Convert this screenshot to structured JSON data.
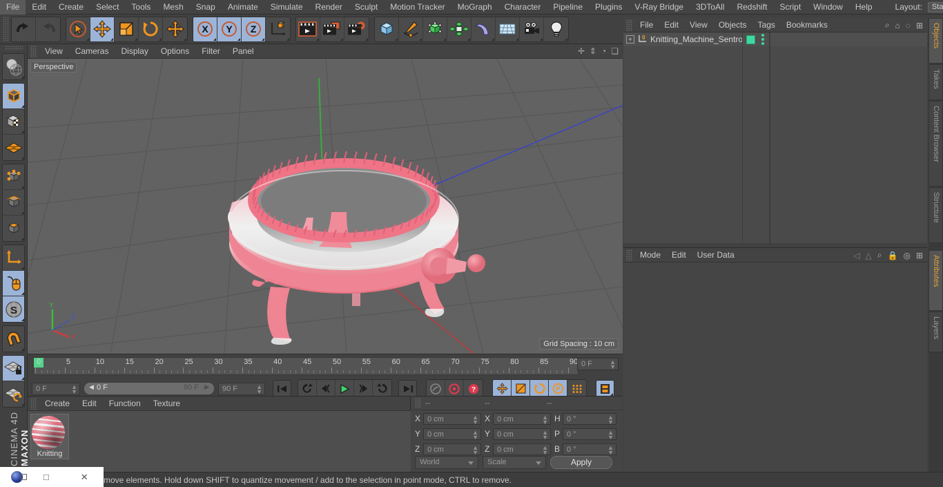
{
  "app": {
    "brand_top": "MAXON",
    "brand_bottom": "CINEMA 4D"
  },
  "menubar": {
    "items": [
      {
        "label": "File"
      },
      {
        "label": "Edit"
      },
      {
        "label": "Create"
      },
      {
        "label": "Select"
      },
      {
        "label": "Tools"
      },
      {
        "label": "Mesh"
      },
      {
        "label": "Snap"
      },
      {
        "label": "Animate"
      },
      {
        "label": "Simulate"
      },
      {
        "label": "Render"
      },
      {
        "label": "Sculpt"
      },
      {
        "label": "Motion Tracker"
      },
      {
        "label": "MoGraph"
      },
      {
        "label": "Character"
      },
      {
        "label": "Pipeline"
      },
      {
        "label": "Plugins"
      },
      {
        "label": "V-Ray Bridge"
      },
      {
        "label": "3DToAll"
      },
      {
        "label": "Redshift"
      },
      {
        "label": "Script"
      },
      {
        "label": "Window"
      },
      {
        "label": "Help"
      }
    ],
    "layout_label": "Layout:",
    "layout_value": "Startup",
    "search_icon": "search-icon"
  },
  "toolbar": {
    "groups": [
      {
        "name": "history",
        "buttons": [
          {
            "name": "undo-button",
            "icon": "undo-arrow-icon",
            "active": false
          },
          {
            "name": "redo-button",
            "icon": "redo-arrow-icon",
            "active": false
          }
        ]
      },
      {
        "name": "transform-tools",
        "buttons": [
          {
            "name": "live-selection-tool",
            "icon": "cursor-circle-icon",
            "active": false
          },
          {
            "name": "move-tool",
            "icon": "move-arrows-icon",
            "active": true
          },
          {
            "name": "scale-tool",
            "icon": "scale-box-icon",
            "active": false
          },
          {
            "name": "rotate-tool",
            "icon": "rotate-circle-icon",
            "active": false
          },
          {
            "name": "coordinate-move-tool",
            "icon": "move-arrows-icon",
            "active": false
          }
        ]
      },
      {
        "name": "axis-locks",
        "buttons": [
          {
            "name": "lock-x-axis",
            "icon": "x-axis-icon",
            "active": true
          },
          {
            "name": "lock-y-axis",
            "icon": "y-axis-icon",
            "active": true
          },
          {
            "name": "lock-z-axis",
            "icon": "z-axis-icon",
            "active": true
          },
          {
            "name": "world-object-axis",
            "icon": "axis-cube-icon",
            "active": false
          }
        ]
      },
      {
        "name": "render-group",
        "buttons": [
          {
            "name": "render-view-button",
            "icon": "clapperboard-icon",
            "active": false
          },
          {
            "name": "render-to-picture-viewer-button",
            "icon": "clapperboard-window-icon",
            "active": false
          },
          {
            "name": "render-settings-button",
            "icon": "clapperboard-gear-icon",
            "active": false
          }
        ]
      },
      {
        "name": "create-group",
        "buttons": [
          {
            "name": "add-cube-button",
            "icon": "blue-cube-icon",
            "active": false
          },
          {
            "name": "add-spline-button",
            "icon": "pen-spline-icon",
            "active": false
          },
          {
            "name": "add-generator-button",
            "icon": "green-cube-icon",
            "active": false
          },
          {
            "name": "add-mograph-button",
            "icon": "green-cluster-icon",
            "active": false
          },
          {
            "name": "add-deformer-button",
            "icon": "bend-deformer-icon",
            "active": false
          },
          {
            "name": "add-scene-object-button",
            "icon": "floor-grid-icon",
            "active": false
          },
          {
            "name": "add-camera-button",
            "icon": "camera-icon",
            "active": false
          },
          {
            "name": "add-light-button",
            "icon": "lightbulb-icon",
            "active": false
          }
        ]
      }
    ]
  },
  "left_toolbar": {
    "groups": [
      {
        "name": "modeling-mode",
        "buttons": [
          {
            "name": "make-editable-button",
            "icon": "globe-sphere-icon",
            "active": false
          }
        ]
      },
      {
        "name": "object-mode-group",
        "buttons": [
          {
            "name": "model-mode-button",
            "icon": "model-cube-icon",
            "active": true
          },
          {
            "name": "texture-mode-button",
            "icon": "texture-checker-cube-icon",
            "active": false
          },
          {
            "name": "workplane-mode-button",
            "icon": "workplane-grid-icon",
            "active": false
          }
        ]
      },
      {
        "name": "component-mode-group",
        "buttons": [
          {
            "name": "points-mode-button",
            "icon": "points-cube-icon",
            "active": false
          },
          {
            "name": "edges-mode-button",
            "icon": "edges-cube-icon",
            "active": false
          },
          {
            "name": "polygons-mode-button",
            "icon": "polygons-cube-icon",
            "active": false
          }
        ]
      },
      {
        "name": "axis-group",
        "buttons": [
          {
            "name": "enable-axis-button",
            "icon": "axis-l-icon",
            "active": false
          },
          {
            "name": "viewport-solo-button",
            "icon": "mouse-icon",
            "active": true
          },
          {
            "name": "symmetry-mode-button",
            "icon": "s-sphere-icon",
            "active": true
          }
        ]
      },
      {
        "name": "snap-group",
        "buttons": [
          {
            "name": "enable-snap-button",
            "icon": "magnet-icon",
            "active": false
          }
        ]
      },
      {
        "name": "workplane-group",
        "buttons": [
          {
            "name": "lock-workplane-button",
            "icon": "workplane-lock-icon",
            "active": true
          },
          {
            "name": "planar-workplane-button",
            "icon": "workplane-rotate-icon",
            "active": false
          }
        ]
      }
    ]
  },
  "viewport": {
    "menu": [
      {
        "label": "View"
      },
      {
        "label": "Cameras"
      },
      {
        "label": "Display"
      },
      {
        "label": "Options"
      },
      {
        "label": "Filter"
      },
      {
        "label": "Panel"
      }
    ],
    "corner_icons": [
      "pan-icon",
      "dolly-icon",
      "rotate-icon",
      "maximize-icon"
    ],
    "view_label": "Perspective",
    "grid_spacing_label": "Grid Spacing : 10 cm",
    "axis_gizmo": {
      "x": "X",
      "y": "Y",
      "z": "Z",
      "x_color": "#d23a3a",
      "y_color": "#3ac03a",
      "z_color": "#3a54d2"
    },
    "model": {
      "name": "knitting-machine-model",
      "body_color": "#e8707f",
      "highlight_color": "#efefef"
    }
  },
  "timeline": {
    "ruler_labels": [
      "0",
      "5",
      "10",
      "15",
      "20",
      "25",
      "30",
      "35",
      "40",
      "45",
      "50",
      "55",
      "60",
      "65",
      "70",
      "75",
      "80",
      "85",
      "90"
    ],
    "range_start": 0,
    "range_end": 90,
    "current_frame_field": "0 F",
    "preview_start": "0 F",
    "preview_end": "90 F",
    "max_frame_field": "90 F",
    "right_frame_field": "0 F",
    "transport": [
      {
        "name": "go-to-start-button",
        "icon": "skip-start-icon",
        "active": false
      },
      {
        "name": "play-backwards-loop-button",
        "icon": "loop-back-icon",
        "active": false
      },
      {
        "name": "step-back-button",
        "icon": "step-back-icon",
        "active": false
      },
      {
        "name": "play-button",
        "icon": "play-icon",
        "active": false
      },
      {
        "name": "step-forward-button",
        "icon": "step-forward-icon",
        "active": false
      },
      {
        "name": "play-forward-loop-button",
        "icon": "loop-forward-icon",
        "active": false
      },
      {
        "name": "go-to-end-button",
        "icon": "skip-end-icon",
        "active": false
      }
    ],
    "record_group": [
      {
        "name": "record-active-objects-button",
        "icon": "key-icon",
        "active": false
      },
      {
        "name": "autokeying-button",
        "icon": "red-circle-icon",
        "active": false
      },
      {
        "name": "keyframe-selection-button",
        "icon": "red-question-icon",
        "active": false
      }
    ],
    "key_toggles": [
      {
        "name": "position-key-button",
        "icon": "move-arrows-icon",
        "active": true
      },
      {
        "name": "scale-key-button",
        "icon": "scale-box-icon",
        "active": true
      },
      {
        "name": "rotation-key-button",
        "icon": "rotate-circle-icon",
        "active": true
      },
      {
        "name": "parameter-key-button",
        "icon": "p-circle-icon",
        "active": true
      },
      {
        "name": "pla-key-button",
        "icon": "dots-grid-icon",
        "active": false
      }
    ],
    "film_button": {
      "name": "timeline-mode-button",
      "icon": "film-strip-icon",
      "active": true
    }
  },
  "material_manager": {
    "menu": [
      {
        "label": "Create"
      },
      {
        "label": "Edit"
      },
      {
        "label": "Function"
      },
      {
        "label": "Texture"
      }
    ],
    "materials": [
      {
        "name": "material-knitting",
        "label": "Knitting",
        "color": "#e8707f"
      }
    ]
  },
  "coordinates": {
    "headers": [
      "--",
      "--",
      "--"
    ],
    "rows": [
      {
        "pos_label": "X",
        "pos_value": "0 cm",
        "size_label": "X",
        "size_value": "0 cm",
        "rot_label": "H",
        "rot_value": "0 °"
      },
      {
        "pos_label": "Y",
        "pos_value": "0 cm",
        "size_label": "Y",
        "size_value": "0 cm",
        "rot_label": "P",
        "rot_value": "0 °"
      },
      {
        "pos_label": "Z",
        "pos_value": "0 cm",
        "size_label": "Z",
        "size_value": "0 cm",
        "rot_label": "B",
        "rot_value": "0 °"
      }
    ],
    "system_value": "World",
    "mode_value": "Scale",
    "apply_label": "Apply"
  },
  "object_manager": {
    "menu": [
      {
        "label": "File"
      },
      {
        "label": "Edit"
      },
      {
        "label": "View"
      },
      {
        "label": "Objects"
      },
      {
        "label": "Tags"
      },
      {
        "label": "Bookmarks"
      }
    ],
    "icons": [
      "search-icon",
      "home-icon",
      "ellipse-icon",
      "plus-box-icon"
    ],
    "objects": [
      {
        "name": "object-knitting-machine",
        "label": "Knitting_Machine_Sentro",
        "expand": "+",
        "tag_color": "#3fd9a0"
      }
    ]
  },
  "attributes_manager": {
    "menu": [
      {
        "label": "Mode"
      },
      {
        "label": "Edit"
      },
      {
        "label": "User Data"
      }
    ],
    "icons": [
      "back-nav-icon",
      "forward-nav-icon",
      "search-icon",
      "lock-icon",
      "target-icon",
      "plus-box-icon"
    ]
  },
  "right_tabs": {
    "top": [
      {
        "label": "Objects",
        "selected": true
      },
      {
        "label": "Takes",
        "selected": false
      },
      {
        "label": "Content Browser",
        "selected": false
      },
      {
        "label": "Structure",
        "selected": false
      }
    ],
    "bottom": [
      {
        "label": "Attributes",
        "selected": true
      },
      {
        "label": "Layers",
        "selected": false
      }
    ]
  },
  "status_bar": {
    "message": "move elements. Hold down SHIFT to quantize movement / add to the selection in point mode, CTRL to remove."
  },
  "window_controls": {
    "logo": "app-logo-icon",
    "restore": "❐",
    "maximize": "□",
    "close": "✕"
  }
}
